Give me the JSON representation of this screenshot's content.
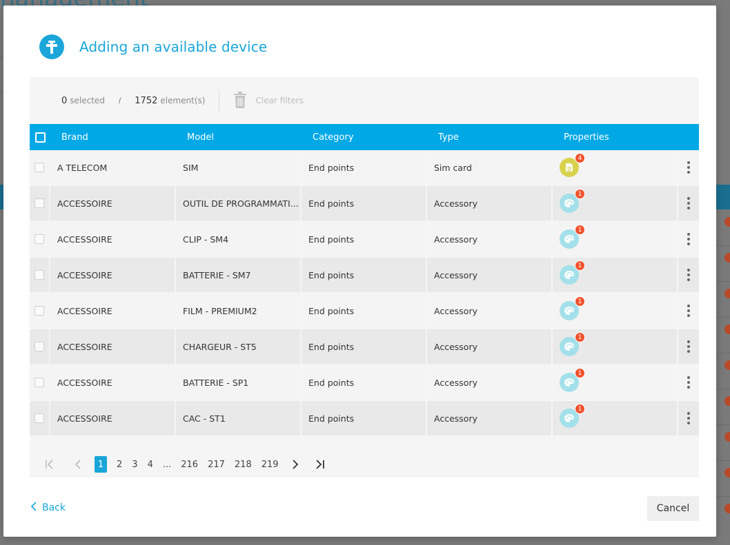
{
  "background": {
    "title_fragment": "nanagement"
  },
  "modal": {
    "title": "Adding an available device",
    "header_icon": "add-device-icon"
  },
  "toolbar": {
    "selected_count": "0",
    "selected_label": "selected",
    "separator": "/",
    "element_count": "1752",
    "element_label": "element(s)",
    "clear_filters_label": "Clear filters"
  },
  "table": {
    "columns": [
      "Brand",
      "Model",
      "Category",
      "Type",
      "Properties"
    ],
    "rows": [
      {
        "brand": "A TELECOM",
        "model": "SIM",
        "category": "End points",
        "type": "Sim card",
        "prop_icon": "sim-card-icon",
        "badge": "4"
      },
      {
        "brand": "ACCESSOIRE",
        "model": "OUTIL DE PROGRAMMATI...",
        "category": "End points",
        "type": "Accessory",
        "prop_icon": "palette-icon",
        "badge": "1"
      },
      {
        "brand": "ACCESSOIRE",
        "model": "CLIP - SM4",
        "category": "End points",
        "type": "Accessory",
        "prop_icon": "palette-icon",
        "badge": "1"
      },
      {
        "brand": "ACCESSOIRE",
        "model": "BATTERIE - SM7",
        "category": "End points",
        "type": "Accessory",
        "prop_icon": "palette-icon",
        "badge": "1"
      },
      {
        "brand": "ACCESSOIRE",
        "model": "FILM - PREMIUM2",
        "category": "End points",
        "type": "Accessory",
        "prop_icon": "palette-icon",
        "badge": "1"
      },
      {
        "brand": "ACCESSOIRE",
        "model": "CHARGEUR - ST5",
        "category": "End points",
        "type": "Accessory",
        "prop_icon": "palette-icon",
        "badge": "1"
      },
      {
        "brand": "ACCESSOIRE",
        "model": "BATTERIE - SP1",
        "category": "End points",
        "type": "Accessory",
        "prop_icon": "palette-icon",
        "badge": "1"
      },
      {
        "brand": "ACCESSOIRE",
        "model": "CAC - ST1",
        "category": "End points",
        "type": "Accessory",
        "prop_icon": "palette-icon",
        "badge": "1"
      }
    ]
  },
  "pagination": {
    "pages": [
      "1",
      "2",
      "3",
      "4",
      "...",
      "216",
      "217",
      "218",
      "219"
    ],
    "current": "1"
  },
  "footer": {
    "back_label": "Back",
    "cancel_label": "Cancel"
  },
  "colors": {
    "accent": "#1aa6d9",
    "header_bar": "#00a8e6",
    "badge": "#f0522c",
    "sim_icon_bg": "#d9d24e",
    "accessory_icon_bg": "#a3e0ea"
  }
}
